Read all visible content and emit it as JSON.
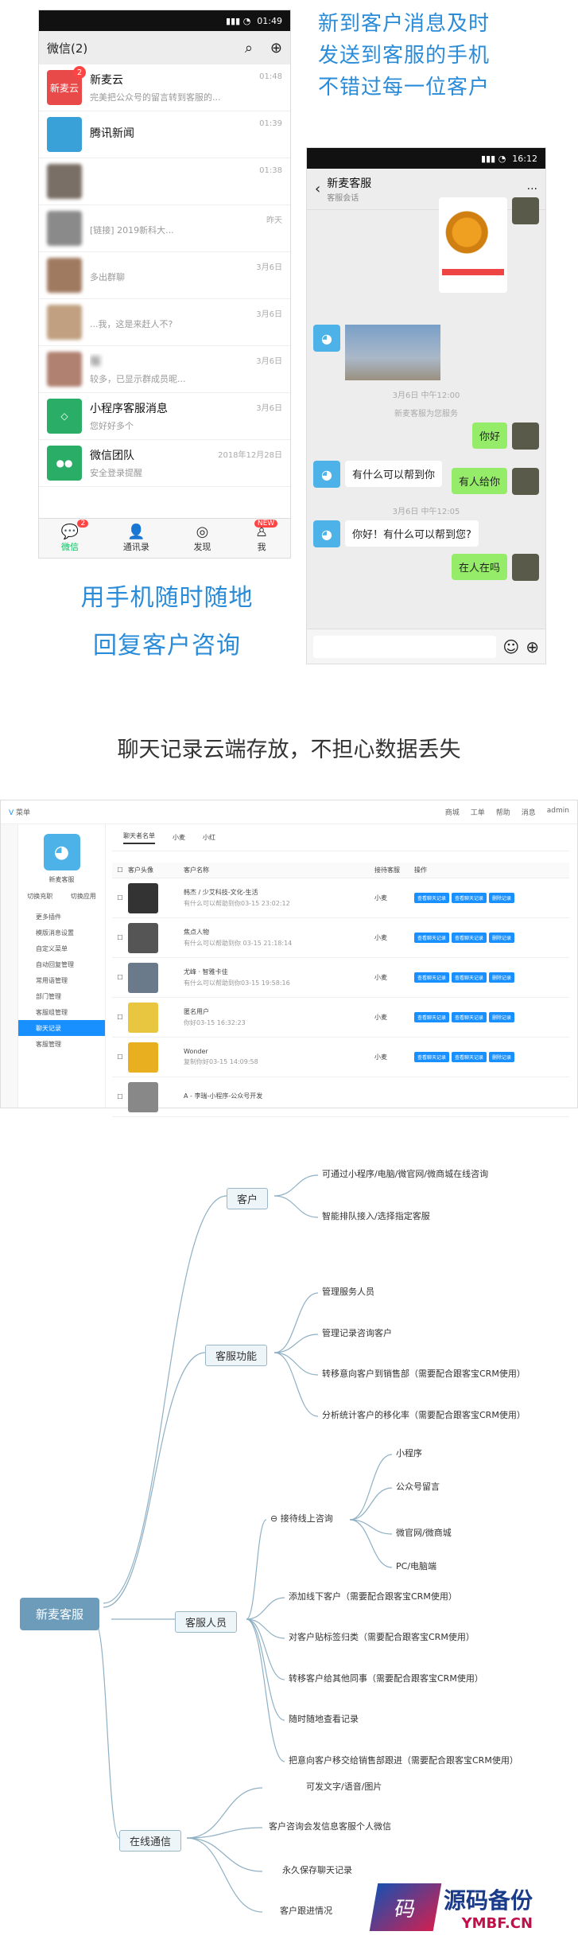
{
  "phone1": {
    "status_time": "01:49",
    "header_title": "微信(2)",
    "chats": [
      {
        "name": "新麦云",
        "preview": "完美把公众号的留言转到客服的...",
        "time": "01:48",
        "badge": "2",
        "color": "#e84a4a",
        "avatar_text": "新麦云"
      },
      {
        "name": "腾讯新闻",
        "preview": "",
        "time": "01:39",
        "badge": "",
        "color": "#3aa0d8",
        "avatar_text": ""
      },
      {
        "name": "",
        "preview": "",
        "time": "01:38",
        "badge": "",
        "color": "#7a6f66",
        "avatar_text": ""
      },
      {
        "name": "",
        "preview": "[链接] 2019新科大...",
        "time": "昨天",
        "badge": "",
        "color": "#8a8a8a",
        "avatar_text": ""
      },
      {
        "name": "",
        "preview": "多出群聊",
        "time": "3月6日",
        "badge": "",
        "color": "#a07a60",
        "avatar_text": ""
      },
      {
        "name": "",
        "preview": "...我，这是来赶人不?",
        "time": "3月6日",
        "badge": "",
        "color": "#c0a080",
        "avatar_text": ""
      },
      {
        "name": "服",
        "preview": "较多，已显示群成员昵...",
        "time": "3月6日",
        "badge": "",
        "color": "#b08070",
        "avatar_text": ""
      },
      {
        "name": "小程序客服消息",
        "preview": "您好好多个",
        "time": "3月6日",
        "badge": "",
        "color": "#2aae67",
        "avatar_text": "◇"
      },
      {
        "name": "微信团队",
        "preview": "安全登录提醒",
        "time": "2018年12月28日",
        "badge": "",
        "color": "#2aae67",
        "avatar_text": "●●"
      }
    ],
    "tabs": [
      {
        "label": "微信",
        "icon": "💬",
        "badge": "2"
      },
      {
        "label": "通讯录",
        "icon": "👤",
        "badge": ""
      },
      {
        "label": "发现",
        "icon": "◎",
        "badge": ""
      },
      {
        "label": "我",
        "icon": "♙",
        "badge": "NEW"
      }
    ]
  },
  "headline_right": [
    "新到客户消息及时",
    "发送到客服的手机",
    "不错过每一位客户"
  ],
  "headline_left": [
    "用手机随时随地",
    "回复客户咨询"
  ],
  "phone2": {
    "status_time": "16:12",
    "title": "新麦客服",
    "subtitle": "客服会话",
    "timestamps": [
      "3月6日 中午12:00",
      "3月6日 中午12:05"
    ],
    "system_msg": "新麦客服为您服务",
    "messages": [
      {
        "from": "user",
        "text": "你好"
      },
      {
        "from": "cs",
        "text": "有什么可以帮到你"
      },
      {
        "from": "user",
        "text": "有人给你"
      },
      {
        "from": "cs",
        "text": "你好！有什么可以帮到您?"
      },
      {
        "from": "user",
        "text": "在人在吗"
      }
    ]
  },
  "section2_title": "聊天记录云端存放，不担心数据丢失",
  "admin": {
    "top_left": "菜单",
    "top_right": [
      "商城",
      "工单",
      "帮助",
      "消息",
      "admin"
    ],
    "brand": "新麦客服",
    "nav_top": [
      "切换充职",
      "切换应用"
    ],
    "nav_items": [
      "更多插件",
      "模版消息设置",
      "自定义菜单",
      "自动回复管理",
      "常用语管理",
      "部门管理",
      "客服组管理",
      "聊天记录",
      "客服管理"
    ],
    "tabs": [
      "聊天者名单",
      "小麦",
      "小红"
    ],
    "headers": [
      "客户头像",
      "客户名称",
      "接待客服",
      "操作"
    ],
    "rows": [
      {
        "name": "韩杰 / 少艾科技-文化-生活",
        "sub": "有什么可以帮助到你03-15 23:02:12",
        "agent": "小麦",
        "color": "#333"
      },
      {
        "name": "焦点人物",
        "sub": "有什么可以帮助到你 03-15 21:18:14",
        "agent": "小麦",
        "color": "#555"
      },
      {
        "name": "尤峰 · 智雅卡佳",
        "sub": "有什么可以帮助到你03-15 19:58:16",
        "agent": "小麦",
        "color": "#6a7a8a"
      },
      {
        "name": "匿名用户",
        "sub": "你好03-15 16:32:23",
        "agent": "小麦",
        "color": "#e8c640"
      },
      {
        "name": "Wonder",
        "sub": "复制你好03-15 14:09:58",
        "agent": "小麦",
        "color": "#e8b020"
      },
      {
        "name": "A - 李瑞-小程序-公众号开发",
        "sub": "",
        "agent": "",
        "color": "#888"
      }
    ],
    "btn_labels": [
      "查看聊天记录",
      "查看聊天记录",
      "删除记录"
    ]
  },
  "mindmap": {
    "root": "新麦客服",
    "branches": [
      {
        "label": "客户",
        "leaves": [
          "可通过小程序/电脑/微官网/微商城在线咨询",
          "智能排队接入/选择指定客服"
        ]
      },
      {
        "label": "客服功能",
        "leaves": [
          "管理服务人员",
          "管理记录咨询客户",
          "转移意向客户到销售部（需要配合跟客宝CRM使用）",
          "分析统计客户的移化率（需要配合跟客宝CRM使用）"
        ]
      },
      {
        "label": "客服人员",
        "sub": "接待线上咨询",
        "sub_leaves": [
          "小程序",
          "公众号留言",
          "微官网/微商城",
          "PC/电脑端"
        ],
        "leaves": [
          "添加线下客户（需要配合跟客宝CRM使用）",
          "对客户贴标签归类（需要配合跟客宝CRM使用）",
          "转移客户给其他同事（需要配合跟客宝CRM使用）",
          "随时随地查看记录",
          "把意向客户移交给销售部跟进（需要配合跟客宝CRM使用）"
        ]
      },
      {
        "label": "在线通信",
        "leaves": [
          "可发文字/语音/图片",
          "客户咨询会发信息客服个人微信",
          "永久保存聊天记录",
          "客户跟进情况"
        ]
      }
    ]
  },
  "logo": {
    "icon_char": "码",
    "title": "源码备份",
    "url": "YMBF.CN"
  }
}
